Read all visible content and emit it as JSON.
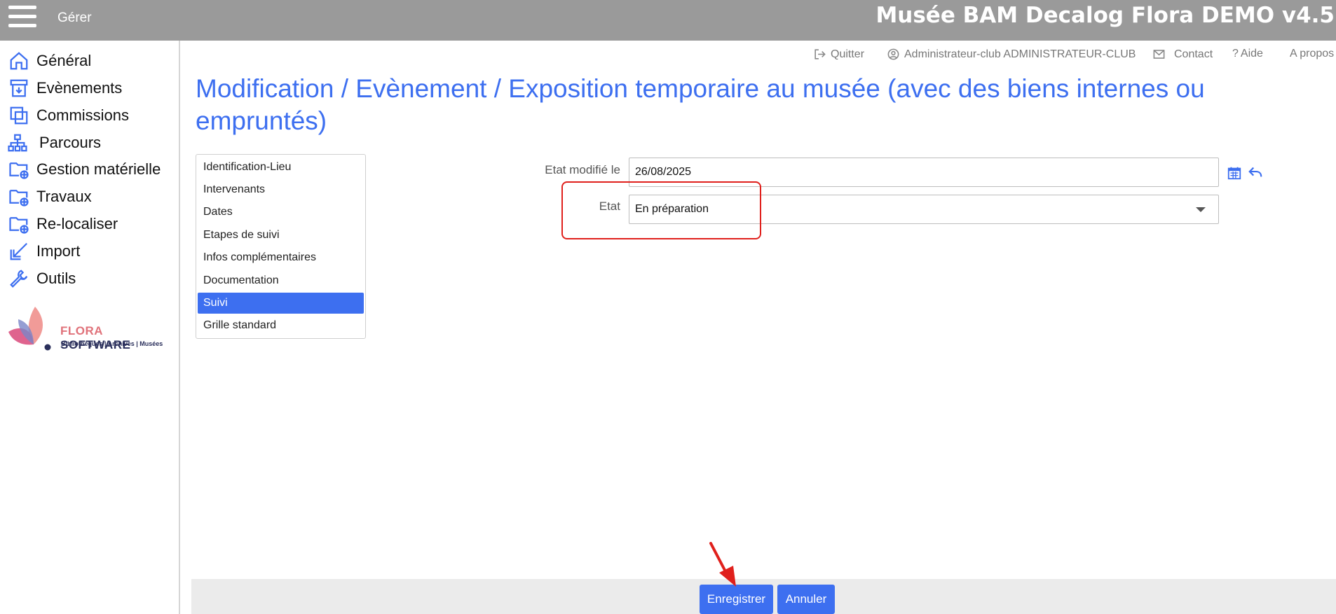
{
  "header": {
    "menu_label": "Gérer",
    "app_title": "Musée BAM Decalog Flora DEMO v4.5"
  },
  "sidebar": {
    "items": [
      {
        "label": "Général",
        "icon": "home-icon"
      },
      {
        "label": "Evènements",
        "icon": "archive-box-icon"
      },
      {
        "label": "Commissions",
        "icon": "copy-stack-icon"
      },
      {
        "label": "Parcours",
        "icon": "sitemap-icon"
      },
      {
        "label": "Gestion matérielle",
        "icon": "folder-globe-icon"
      },
      {
        "label": "Travaux",
        "icon": "folder-globe-icon"
      },
      {
        "label": "Re-localiser",
        "icon": "folder-globe-icon"
      },
      {
        "label": "Import",
        "icon": "import-arrow-icon"
      },
      {
        "label": "Outils",
        "icon": "wrench-icon"
      }
    ],
    "logo": {
      "brand_a": "FLORA",
      "brand_b": " SOFTWARE",
      "tagline": "Bibliothèques | Archives | Musées"
    }
  },
  "toplinks": {
    "quit": "Quitter",
    "user": "Administrateur-club ADMINISTRATEUR-CLUB",
    "contact": "Contact",
    "help": "Aide",
    "about": "A propos"
  },
  "page": {
    "title": "Modification / Evènement / Exposition temporaire au musée (avec des biens internes ou empruntés)"
  },
  "tabs": [
    {
      "label": "Identification-Lieu"
    },
    {
      "label": "Intervenants"
    },
    {
      "label": "Dates"
    },
    {
      "label": "Etapes de suivi"
    },
    {
      "label": "Infos complémentaires"
    },
    {
      "label": "Documentation"
    },
    {
      "label": "Suivi"
    },
    {
      "label": "Grille standard"
    }
  ],
  "active_tab": "Suivi",
  "form": {
    "date_label": "Etat modifié le",
    "date_value": "26/08/2025",
    "state_label": "Etat",
    "state_value": "En préparation"
  },
  "footer": {
    "save_label": "Enregistrer",
    "cancel_label": "Annuler"
  },
  "colors": {
    "accent": "#3d6ff0",
    "topbar": "#9a9a9a",
    "highlight": "#e0201c"
  }
}
